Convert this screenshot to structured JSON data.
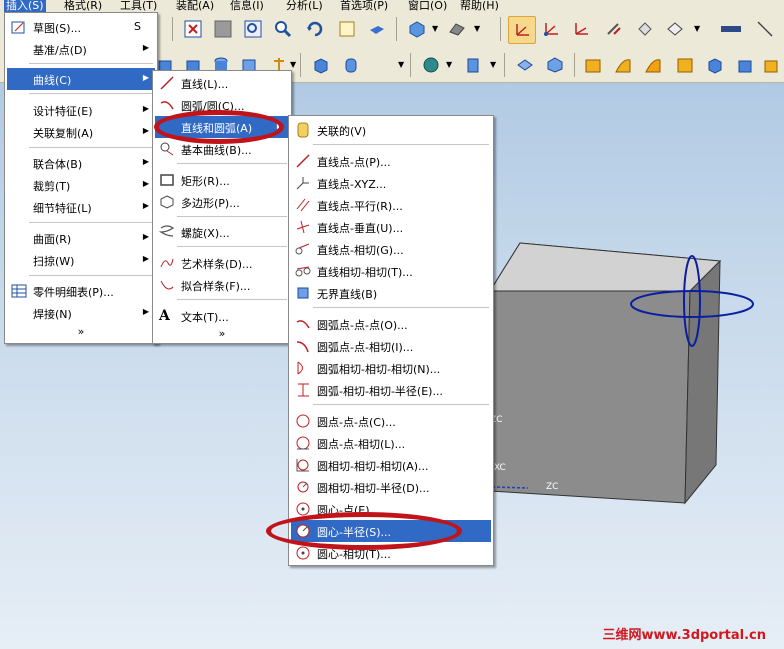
{
  "menubar": {
    "items": [
      "插入(S)",
      "格式(R)",
      "工具(T)",
      "装配(A)",
      "信息(I)",
      "分析(L)",
      "首选项(P)",
      "窗口(O)",
      "帮助(H)"
    ]
  },
  "toolbar": {
    "row1_icons": [
      "fit-view-icon",
      "shaded-icon",
      "zoom-window-icon",
      "zoom-icon",
      "rotate-icon",
      "pan-icon",
      "render-icon",
      "view-orientation-icon",
      "surface-icon",
      "csys-icon",
      "datum-csys-icon",
      "wcs-icon",
      "wcs-dynamic-icon",
      "wcs-rotate-icon",
      "layer-icon",
      "selection-icon"
    ],
    "row2_icons": [
      "sketch-icon",
      "extrude-icon",
      "revolve-icon",
      "hole-icon",
      "cylinder-icon",
      "point-icon",
      "plane-icon",
      "block-icon",
      "cylinder-feature-icon",
      "cone-icon",
      "sphere-icon",
      "boss-icon",
      "pocket-icon",
      "pad-icon",
      "slot-icon",
      "groove-icon"
    ]
  },
  "menu_insert": {
    "items": [
      {
        "label": "草图(S)...",
        "shortcut": "S",
        "icon": "sketch-icon",
        "submenu": false
      },
      {
        "label": "基准/点(D)",
        "icon": "",
        "submenu": true
      },
      {
        "label": "曲线(C)",
        "icon": "",
        "submenu": true,
        "highlighted": true
      },
      {
        "label": "设计特征(E)",
        "icon": "",
        "submenu": true
      },
      {
        "label": "关联复制(A)",
        "icon": "",
        "submenu": true
      },
      {
        "label": "联合体(B)",
        "icon": "",
        "submenu": true
      },
      {
        "label": "裁剪(T)",
        "icon": "",
        "submenu": true
      },
      {
        "label": "细节特征(L)",
        "icon": "",
        "submenu": true
      },
      {
        "label": "曲面(R)",
        "icon": "",
        "submenu": true
      },
      {
        "label": "扫掠(W)",
        "icon": "",
        "submenu": true
      },
      {
        "label": "零件明细表(P)...",
        "icon": "parts-list-icon",
        "submenu": false
      },
      {
        "label": "焊接(N)",
        "icon": "",
        "submenu": true
      }
    ],
    "more": "»"
  },
  "menu_curve": {
    "items": [
      {
        "label": "直线(L)...",
        "icon": "line-icon",
        "submenu": false
      },
      {
        "label": "圆弧/圆(C)...",
        "icon": "arc-icon",
        "submenu": false
      },
      {
        "label": "直线和圆弧(A)",
        "icon": "",
        "submenu": true,
        "highlighted": true
      },
      {
        "label": "基本曲线(B)...",
        "icon": "basic-curve-icon",
        "submenu": false
      },
      {
        "label": "矩形(R)...",
        "icon": "rectangle-icon",
        "submenu": false
      },
      {
        "label": "多边形(P)...",
        "icon": "polygon-icon",
        "submenu": false
      },
      {
        "label": "螺旋(X)...",
        "icon": "helix-icon",
        "submenu": false
      },
      {
        "label": "艺术样条(D)...",
        "icon": "studio-spline-icon",
        "submenu": false
      },
      {
        "label": "拟合样条(F)...",
        "icon": "fit-spline-icon",
        "submenu": false
      },
      {
        "label": "文本(T)...",
        "icon": "text-icon",
        "submenu": false
      }
    ],
    "more": "»"
  },
  "menu_line_arc": {
    "items": [
      {
        "label": "关联的(V)",
        "icon": "associative-icon"
      },
      {
        "label": "直线点-点(P)...",
        "icon": "line-point-point-icon"
      },
      {
        "label": "直线点-XYZ...",
        "icon": "line-point-xyz-icon"
      },
      {
        "label": "直线点-平行(R)...",
        "icon": "line-parallel-icon"
      },
      {
        "label": "直线点-垂直(U)...",
        "icon": "line-perpendicular-icon"
      },
      {
        "label": "直线点-相切(G)...",
        "icon": "line-tangent-icon"
      },
      {
        "label": "直线相切-相切(T)...",
        "icon": "line-tangent-tangent-icon"
      },
      {
        "label": "无界直线(B)",
        "icon": "infinite-line-icon"
      },
      {
        "label": "圆弧点-点-点(O)...",
        "icon": "arc-3point-icon"
      },
      {
        "label": "圆弧点-点-相切(I)...",
        "icon": "arc-point-point-tangent-icon"
      },
      {
        "label": "圆弧相切-相切-相切(N)...",
        "icon": "arc-3tangent-icon"
      },
      {
        "label": "圆弧-相切-相切-半径(E)...",
        "icon": "arc-tangent-radius-icon"
      },
      {
        "label": "圆点-点-点(C)...",
        "icon": "circle-3point-icon"
      },
      {
        "label": "圆点-点-相切(L)...",
        "icon": "circle-point-tangent-icon"
      },
      {
        "label": "圆相切-相切-相切(A)...",
        "icon": "circle-3tangent-icon"
      },
      {
        "label": "圆相切-相切-半径(D)...",
        "icon": "circle-tangent-radius-icon"
      },
      {
        "label": "圆心-点(E)...",
        "icon": "circle-center-point-icon"
      },
      {
        "label": "圆心-半径(S)...",
        "icon": "circle-center-radius-icon",
        "highlighted": true
      },
      {
        "label": "圆心-相切(T)...",
        "icon": "circle-center-tangent-icon"
      }
    ]
  },
  "viewport": {
    "axis_labels": [
      "ZC",
      "XC",
      "ZC"
    ]
  },
  "watermark": "三维网www.3dportal.cn",
  "colors": {
    "highlight": "#316ac5",
    "annotation": "#c0141a",
    "circle": "#0a1ea0"
  }
}
